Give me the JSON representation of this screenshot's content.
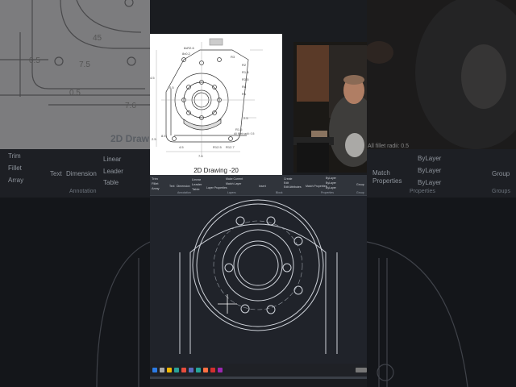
{
  "reference": {
    "caption": "2D Drawing -20",
    "dims": [
      "8xR2.6",
      "8x0.2",
      "R3",
      "R2",
      "R1.5",
      "R3.5",
      "4.5",
      "R8",
      "R1",
      "8.5",
      "4.5",
      "R12.5",
      "R12.7",
      "2.5",
      "7.6",
      "2.5",
      "R1.5",
      "0.5",
      "All fillet radii: 0.5"
    ],
    "title_bg": "2D Draw",
    "bg_dims": [
      "45",
      "0.5",
      "7.5",
      "0.5",
      "7.6"
    ],
    "bg_note": "All fillet radii: 0.5"
  },
  "ribbon": {
    "left_items": [
      "Trim",
      "Fillet",
      "Array",
      "Text",
      "Dimension",
      "Linear",
      "Leader",
      "Table"
    ],
    "center_items": [
      "Layer Properties",
      "Make Current",
      "Match Layer",
      "Insert",
      "Create",
      "Edit",
      "Edit Attributes"
    ],
    "right_items": [
      "Match Properties",
      "ByLayer",
      "ByLayer",
      "ByLayer",
      "Group"
    ],
    "groups": [
      "Annotation",
      "Layers",
      "Block",
      "Properties",
      "Group"
    ]
  },
  "background_ribbon": {
    "labels": [
      "Trim",
      "Fillet",
      "Array",
      "Text",
      "Dimension",
      "Linear",
      "Leader",
      "Table",
      "Match",
      "Properties",
      "ByLayer",
      "ByLayer",
      "ByLayer",
      "Group"
    ],
    "groups": [
      "Annotation",
      "Properties",
      "Groups"
    ]
  },
  "colors": {
    "background": "#1a1c20",
    "reference_bg": "#ffffff",
    "cad_bg": "#20232a",
    "cad_lines": "#cfd3da",
    "ribbon": "#30343b"
  }
}
